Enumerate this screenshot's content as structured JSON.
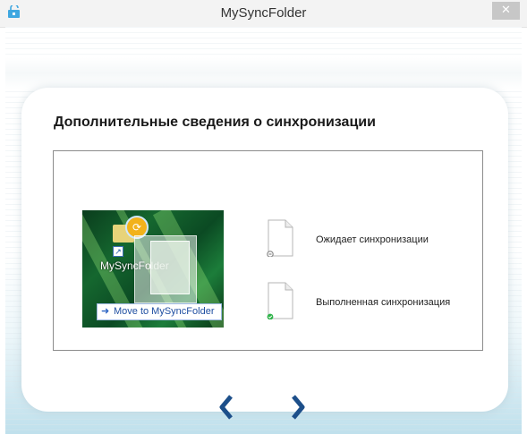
{
  "window": {
    "title": "MySyncFolder",
    "close_glyph": "✕"
  },
  "heading": "Дополнительные сведения о синхронизации",
  "illustration": {
    "icon_label": "MySyncFolder",
    "menu_item": "Move to MySyncFolder",
    "menu_arrow": "➜"
  },
  "status": [
    {
      "label": "Ожидает синхронизации",
      "badge": "pending",
      "badge_color": "#8a8a8a"
    },
    {
      "label": "Выполненная синхронизация",
      "badge": "synced",
      "badge_color": "#2fb34a"
    }
  ],
  "navigation": {
    "prev_icon": "chevron-left-icon",
    "next_icon": "chevron-right-icon",
    "color": "#1d4f8a"
  }
}
